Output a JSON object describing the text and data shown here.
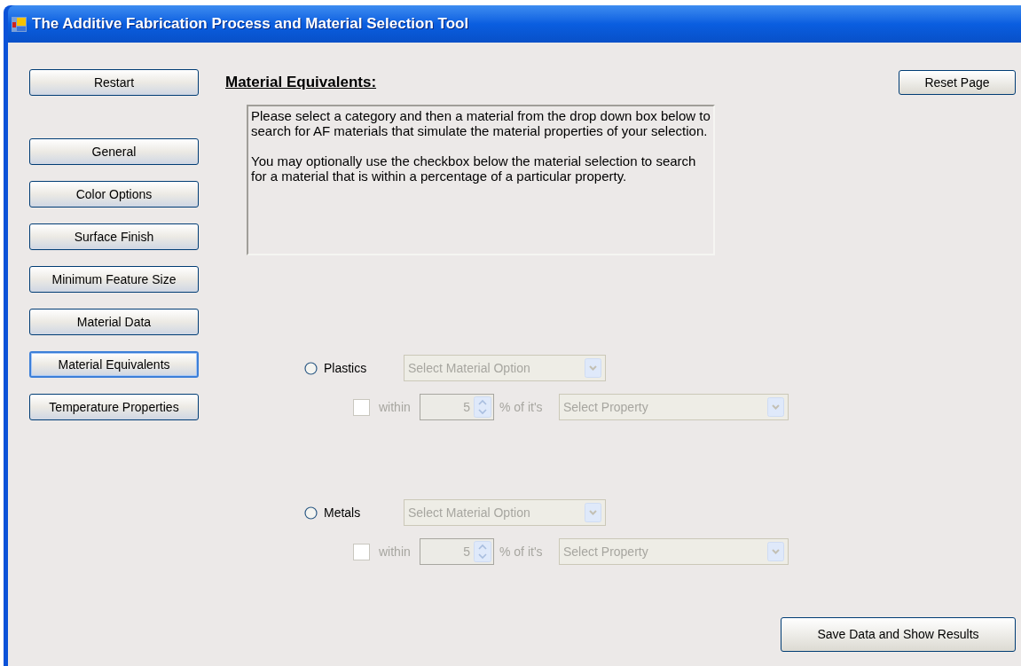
{
  "window": {
    "title": "The Additive Fabrication Process and Material Selection Tool"
  },
  "restart_button": "Restart",
  "nav": [
    {
      "label": "General",
      "selected": false
    },
    {
      "label": "Color Options",
      "selected": false
    },
    {
      "label": "Surface Finish",
      "selected": false
    },
    {
      "label": "Minimum Feature Size",
      "selected": false
    },
    {
      "label": "Material Data",
      "selected": false
    },
    {
      "label": "Material Equivalents",
      "selected": true
    },
    {
      "label": "Temperature Properties",
      "selected": false
    }
  ],
  "heading": "Material Equivalents:",
  "reset_button": "Reset Page",
  "instructions": [
    "Please select a category and then a material from the drop down box below to search for AF materials that simulate the material properties of your selection.",
    "You may optionally use the checkbox below the material selection to search for a material that is within a percentage of a particular property."
  ],
  "categories": [
    {
      "label": "Plastics",
      "selected": false,
      "disabled": true,
      "material_select": "Select Material Option",
      "within_label": "within",
      "within_checked": false,
      "percent": "5",
      "of_label": "% of it's",
      "property_select": "Select Property"
    },
    {
      "label": "Metals",
      "selected": false,
      "disabled": true,
      "material_select": "Select Material Option",
      "within_label": "within",
      "within_checked": false,
      "percent": "5",
      "of_label": "% of it's",
      "property_select": "Select Property"
    }
  ],
  "save_button": "Save Data and Show Results"
}
